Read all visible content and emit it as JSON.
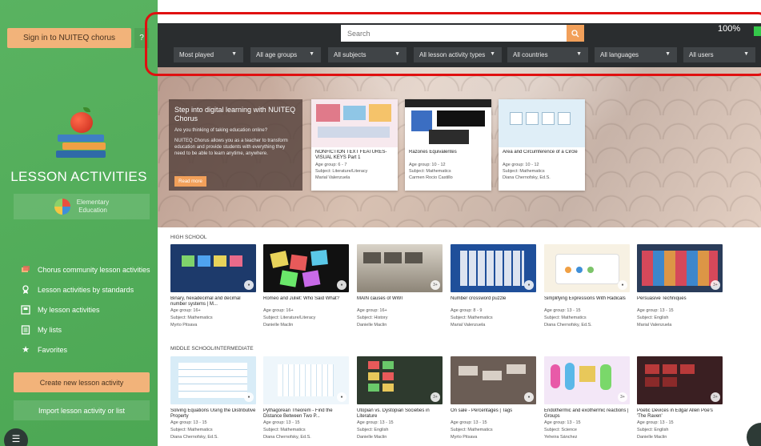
{
  "sidebar": {
    "signin_label": "Sign in to NUITEQ chorus",
    "help_label": "?",
    "title": "LESSON ACTIVITIES",
    "education_label_line1": "Elementary",
    "education_label_line2": "Education",
    "nav": [
      {
        "label": "Chorus community lesson activities",
        "icon": "community-icon"
      },
      {
        "label": "Lesson activities by standards",
        "icon": "standards-icon"
      },
      {
        "label": "My lesson activities",
        "icon": "my-activities-icon"
      },
      {
        "label": "My lists",
        "icon": "list-icon"
      },
      {
        "label": "Favorites",
        "icon": "star-icon"
      }
    ],
    "create_label": "Create new lesson activity",
    "import_label": "Import lesson activity or list",
    "menu_glyph": "☰"
  },
  "topbar": {
    "search_placeholder": "Search",
    "zoom": "100%",
    "filters": [
      "Most played",
      "All age groups",
      "All subjects",
      "All lesson activity types",
      "All countries",
      "All languages",
      "All users"
    ]
  },
  "hero": {
    "promo_title": "Step into digital learning with NUITEQ Chorus",
    "promo_question": "Are you thinking of taking education online?",
    "promo_body": "NUITEQ Chorus allows you as a teacher to transform education and provide students with everything they need to be able to learn anytime, anywhere.",
    "read_more": "Read more",
    "cards": [
      {
        "title": "NONFICTION TEXT FEATURES-VISUAL KEYS Part 1",
        "age": "Age group: 6 - 7",
        "subject": "Subject: Literature/Literacy",
        "author": "Marial Valenzuela"
      },
      {
        "title": "Razones Equivalentes",
        "age": "Age group: 10 - 12",
        "subject": "Subject: Mathematics",
        "author": "Carmen Rocio Castillo"
      },
      {
        "title": "Area and Circumference of a Circle",
        "age": "Age group: 10 - 12",
        "subject": "Subject: Mathematics",
        "author": "Diana Chernofsky, Ed.S."
      }
    ]
  },
  "sections": [
    {
      "label": "HIGH SCHOOL",
      "cards": [
        {
          "title": "Binary, hexadecimal and decimal number systems | M...",
          "age": "Age group: 16+",
          "subject": "Subject: Mathematics",
          "author": "Myrto Pitsava"
        },
        {
          "title": "Romeo and Juliet: Who Said What?",
          "age": "Age group: 16+",
          "subject": "Subject: Literature/Literacy",
          "author": "Danielle Maclin"
        },
        {
          "title": "MAIN causes of WWI",
          "age": "Age group: 16+",
          "subject": "Subject: History",
          "author": "Danielle Maclin"
        },
        {
          "title": "Number crossword puzzle",
          "age": "Age group: 8 - 9",
          "subject": "Subject: Mathematics",
          "author": "Marial Valenzuela"
        },
        {
          "title": "Simplifying Expressions With Radicals",
          "age": "Age group: 13 - 15",
          "subject": "Subject: Mathematics",
          "author": "Diana Chernofsky, Ed.S."
        },
        {
          "title": "Persuasive Techniques",
          "age": "Age group: 13 - 15",
          "subject": "Subject: English",
          "author": "Marial Valenzuela"
        }
      ]
    },
    {
      "label": "MIDDLE SCHOOL/INTERMEDIATE",
      "cards": [
        {
          "title": "Solving Equations Using the Distributive Property",
          "age": "Age group: 13 - 15",
          "subject": "Subject: Mathematics",
          "author": "Diana Chernofsky, Ed.S."
        },
        {
          "title": "Pythagorean Theorem - Find the Distance Between Two P...",
          "age": "Age group: 13 - 15",
          "subject": "Subject: Mathematics",
          "author": "Diana Chernofsky, Ed.S."
        },
        {
          "title": "Utopian vs. Dystopian Societies in Literature",
          "age": "Age group: 13 - 15",
          "subject": "Subject: English",
          "author": "Danielle Maclin"
        },
        {
          "title": "On sale - Percentages | Tags",
          "age": "Age group: 13 - 15",
          "subject": "Subject: Mathematics",
          "author": "Myrto Pitsava"
        },
        {
          "title": "Endothermic and exothermic reactions | Groups",
          "age": "Age group: 13 - 15",
          "subject": "Subject: Science",
          "author": "Yeheira Sánchez"
        },
        {
          "title": "Poetic Devices in Edgar Allen Poe's 'The Raven'",
          "age": "Age group: 13 - 15",
          "subject": "Subject: English",
          "author": "Danielle Maclin"
        }
      ]
    }
  ],
  "colors": {
    "sidebar": "#4fae57",
    "accent": "#f2b37a",
    "topbar": "#2a2d2f",
    "highlight": "#e01010"
  }
}
